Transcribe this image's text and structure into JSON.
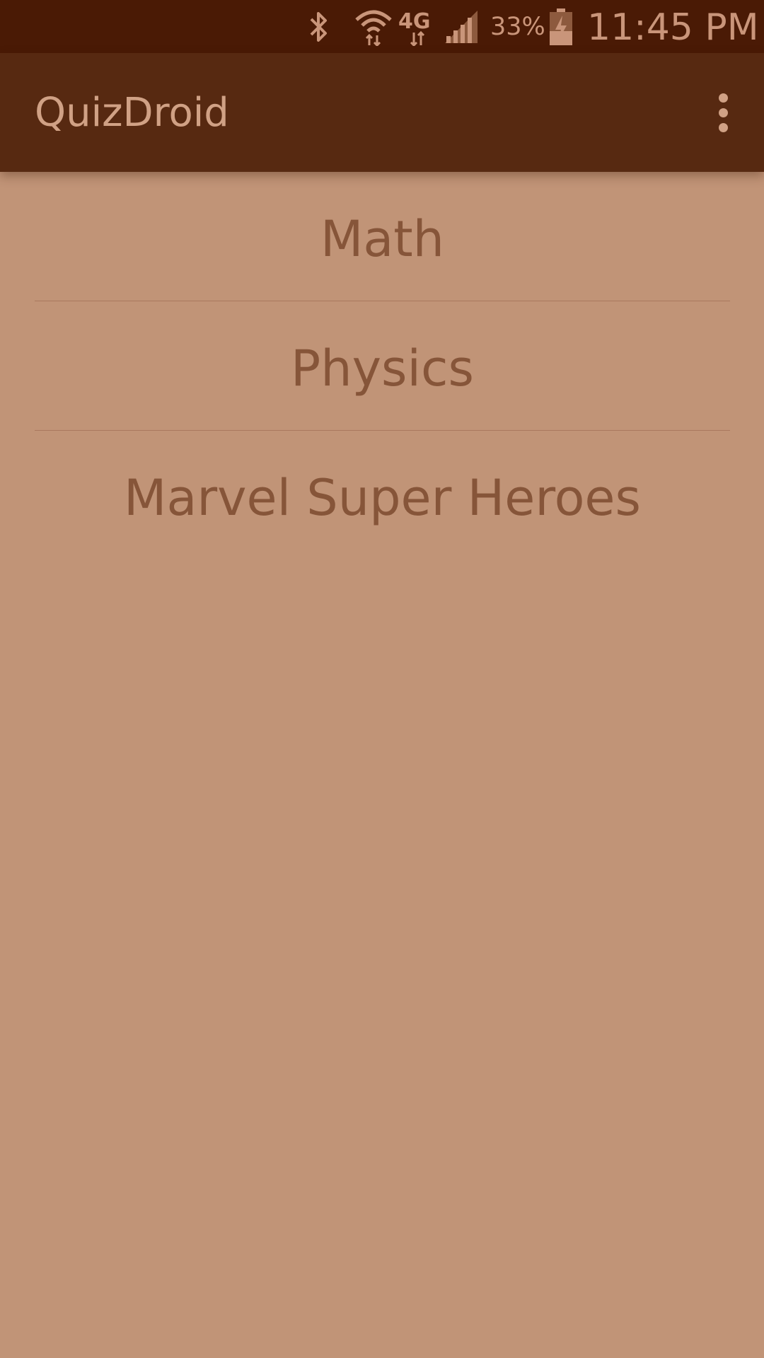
{
  "status_bar": {
    "icons": [
      "bluetooth-icon",
      "wifi-icon",
      "lte-4g-icon",
      "signal-icon",
      "battery-charging-icon"
    ],
    "battery_text": "33%",
    "time": "11:45 PM",
    "network_label": "4G"
  },
  "app_bar": {
    "title": "QuizDroid",
    "overflow_icon": "more-vert-icon"
  },
  "topics": [
    {
      "label": "Math"
    },
    {
      "label": "Physics"
    },
    {
      "label": "Marvel Super Heroes"
    }
  ],
  "colors": {
    "status_bar_bg": "#4a1a05",
    "app_bar_bg": "#572911",
    "page_bg": "#c19477",
    "list_text": "#865539",
    "title_text": "#d0a185"
  }
}
